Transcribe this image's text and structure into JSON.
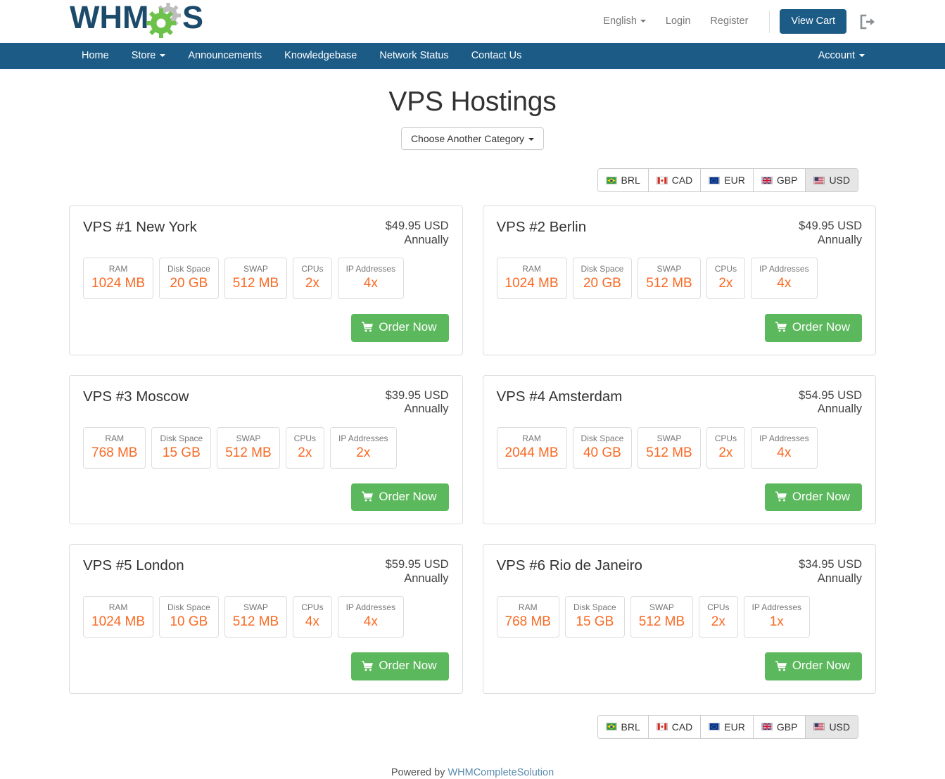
{
  "header": {
    "logo_text": "WHMCS",
    "language": "English",
    "login": "Login",
    "register": "Register",
    "view_cart": "View Cart",
    "logout_icon": "sign-out-icon"
  },
  "nav": {
    "items": [
      {
        "label": "Home"
      },
      {
        "label": "Store",
        "caret": true
      },
      {
        "label": "Announcements"
      },
      {
        "label": "Knowledgebase"
      },
      {
        "label": "Network Status"
      },
      {
        "label": "Contact Us"
      }
    ],
    "account": "Account"
  },
  "page": {
    "title": "VPS Hostings",
    "category_button": "Choose Another Category"
  },
  "currencies": [
    {
      "code": "BRL",
      "flag": "brazil-flag-icon",
      "active": false
    },
    {
      "code": "CAD",
      "flag": "canada-flag-icon",
      "active": false
    },
    {
      "code": "EUR",
      "flag": "eu-flag-icon",
      "active": false
    },
    {
      "code": "GBP",
      "flag": "uk-flag-icon",
      "active": false
    },
    {
      "code": "USD",
      "flag": "usa-flag-icon",
      "active": true
    }
  ],
  "spec_labels": {
    "ram": "RAM",
    "disk": "Disk Space",
    "swap": "SWAP",
    "cpus": "CPUs",
    "ips": "IP Addresses"
  },
  "order_label": "Order Now",
  "products": [
    {
      "name": "VPS #1 New York",
      "price": "$49.95 USD",
      "cycle": "Annually",
      "specs": [
        {
          "label": "RAM",
          "value": "1024 MB"
        },
        {
          "label": "Disk Space",
          "value": "20 GB"
        },
        {
          "label": "SWAP",
          "value": "512 MB"
        },
        {
          "label": "CPUs",
          "value": "2x"
        },
        {
          "label": "IP Addresses",
          "value": "4x"
        }
      ]
    },
    {
      "name": "VPS #2 Berlin",
      "price": "$49.95 USD",
      "cycle": "Annually",
      "specs": [
        {
          "label": "RAM",
          "value": "1024 MB"
        },
        {
          "label": "Disk Space",
          "value": "20 GB"
        },
        {
          "label": "SWAP",
          "value": "512 MB"
        },
        {
          "label": "CPUs",
          "value": "2x"
        },
        {
          "label": "IP Addresses",
          "value": "4x"
        }
      ]
    },
    {
      "name": "VPS #3 Moscow",
      "price": "$39.95 USD",
      "cycle": "Annually",
      "specs": [
        {
          "label": "RAM",
          "value": "768 MB"
        },
        {
          "label": "Disk Space",
          "value": "15 GB"
        },
        {
          "label": "SWAP",
          "value": "512 MB"
        },
        {
          "label": "CPUs",
          "value": "2x"
        },
        {
          "label": "IP Addresses",
          "value": "2x"
        }
      ]
    },
    {
      "name": "VPS #4 Amsterdam",
      "price": "$54.95 USD",
      "cycle": "Annually",
      "specs": [
        {
          "label": "RAM",
          "value": "2044 MB"
        },
        {
          "label": "Disk Space",
          "value": "40 GB"
        },
        {
          "label": "SWAP",
          "value": "512 MB"
        },
        {
          "label": "CPUs",
          "value": "2x"
        },
        {
          "label": "IP Addresses",
          "value": "4x"
        }
      ]
    },
    {
      "name": "VPS #5 London",
      "price": "$59.95 USD",
      "cycle": "Annually",
      "specs": [
        {
          "label": "RAM",
          "value": "1024 MB"
        },
        {
          "label": "Disk Space",
          "value": "10 GB"
        },
        {
          "label": "SWAP",
          "value": "512 MB"
        },
        {
          "label": "CPUs",
          "value": "4x"
        },
        {
          "label": "IP Addresses",
          "value": "4x"
        }
      ]
    },
    {
      "name": "VPS #6 Rio de Janeiro",
      "price": "$34.95 USD",
      "cycle": "Annually",
      "specs": [
        {
          "label": "RAM",
          "value": "768 MB"
        },
        {
          "label": "Disk Space",
          "value": "15 GB"
        },
        {
          "label": "SWAP",
          "value": "512 MB"
        },
        {
          "label": "CPUs",
          "value": "2x"
        },
        {
          "label": "IP Addresses",
          "value": "1x"
        }
      ]
    }
  ],
  "footer": {
    "prefix": "Powered by ",
    "link": "WHMCompleteSolution"
  },
  "colors": {
    "navy": "#1b5b86",
    "green": "#5cb85c",
    "orange": "#f96a24",
    "gray_label": "#777777"
  }
}
